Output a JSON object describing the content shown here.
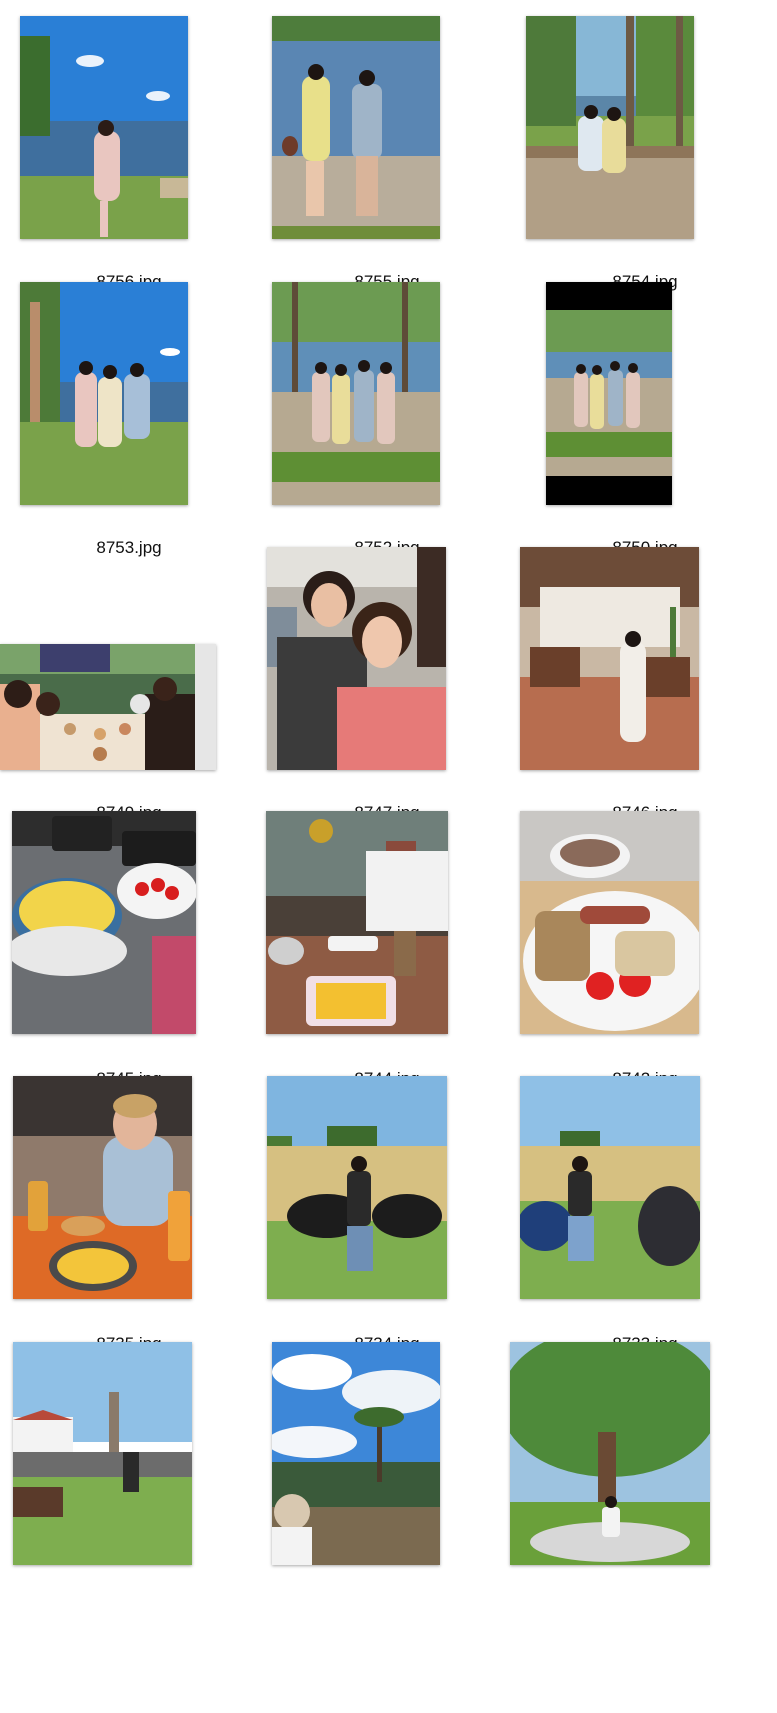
{
  "files": [
    {
      "name": "8756.jpg",
      "kind": "lake-portrait"
    },
    {
      "name": "8755.jpg",
      "kind": "pier-couple"
    },
    {
      "name": "8754.jpg",
      "kind": "park-bench"
    },
    {
      "name": "8753.jpg",
      "kind": "palm-group"
    },
    {
      "name": "8752.jpg",
      "kind": "trees-group"
    },
    {
      "name": "8750.jpg",
      "kind": "trees-group-letterbox"
    },
    {
      "name": "8749.jpg",
      "kind": "dinner-selfie"
    },
    {
      "name": "8747.jpg",
      "kind": "mall-selfie"
    },
    {
      "name": "8746.jpg",
      "kind": "hall-portrait"
    },
    {
      "name": "8745.jpg",
      "kind": "breakfast-desk"
    },
    {
      "name": "8744.jpg",
      "kind": "cafe-table"
    },
    {
      "name": "8742.jpg",
      "kind": "breakfast-plate"
    },
    {
      "name": "8735.jpg",
      "kind": "beer-hall"
    },
    {
      "name": "8734.jpg",
      "kind": "field-motorbike"
    },
    {
      "name": "8733.jpg",
      "kind": "field-two-bikes"
    },
    {
      "name": "",
      "kind": "village-festival"
    },
    {
      "name": "",
      "kind": "palm-sky"
    },
    {
      "name": "",
      "kind": "big-tree"
    }
  ]
}
